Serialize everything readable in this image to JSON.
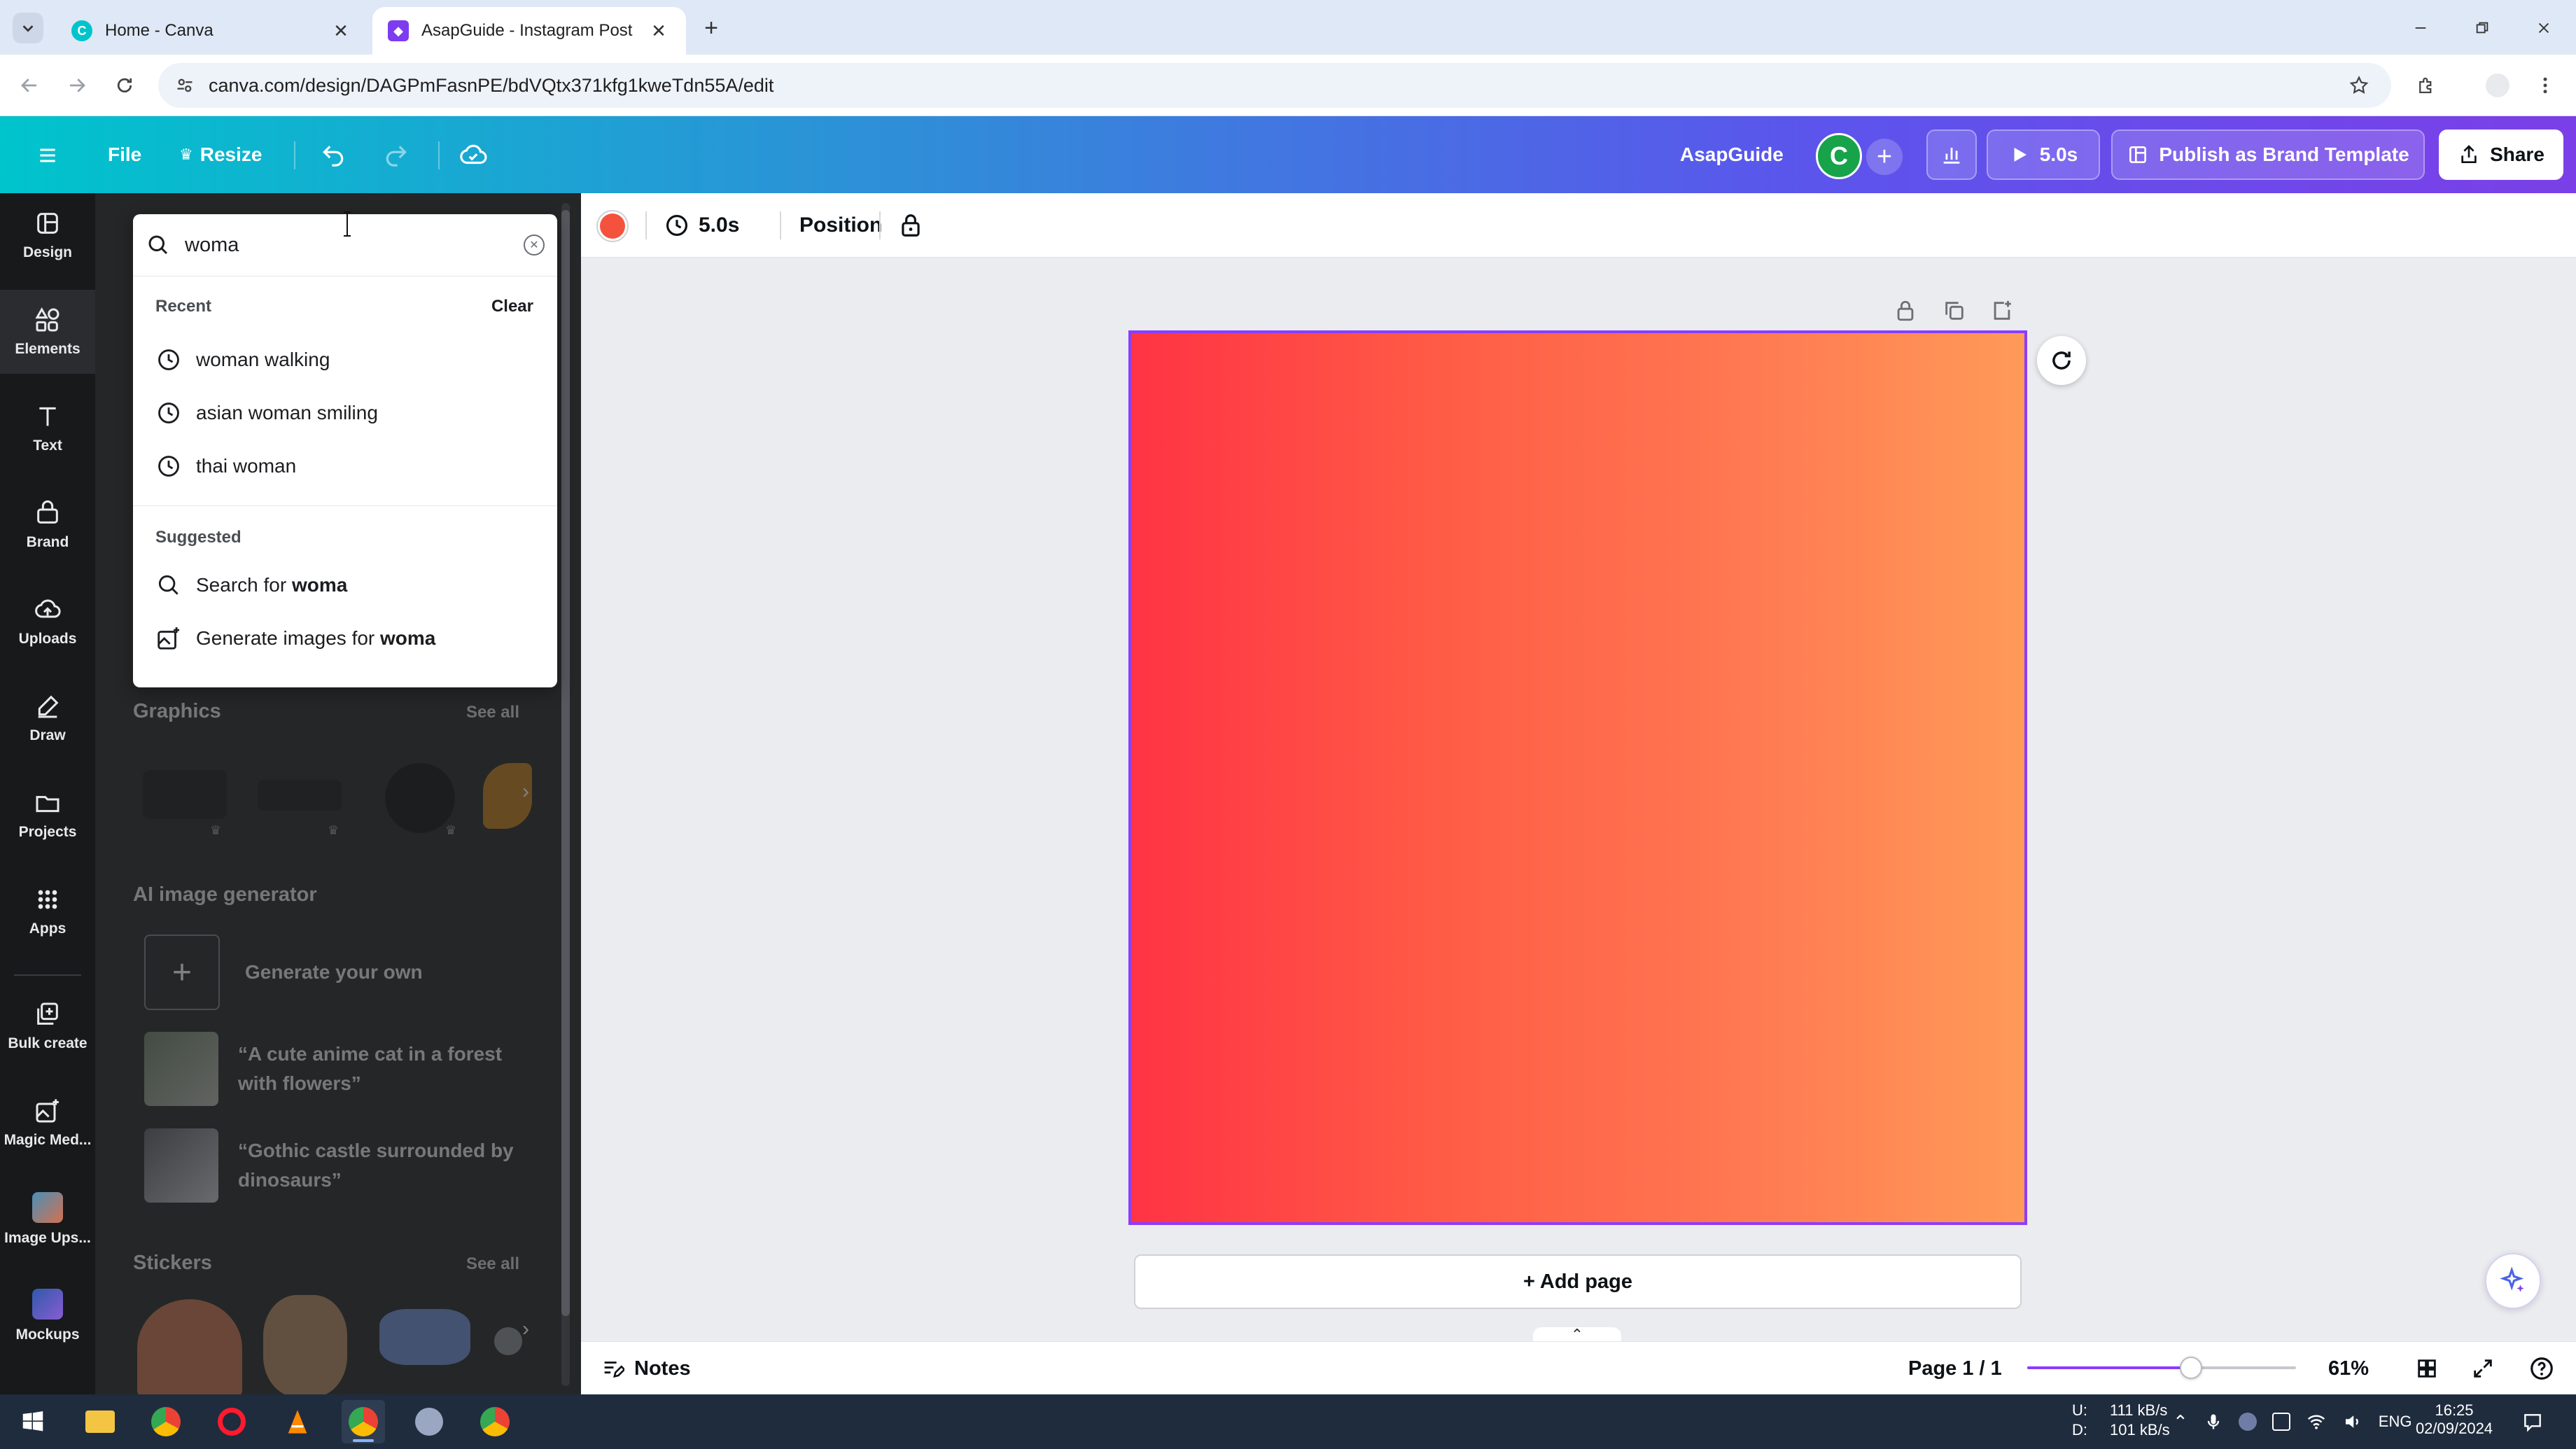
{
  "browser": {
    "tabs": [
      {
        "title": "Home - Canva",
        "active": false
      },
      {
        "title": "AsapGuide - Instagram Post",
        "active": true
      }
    ],
    "url": "canva.com/design/DAGPmFasnPE/bdVQtx371kfg1kweTdn55A/edit"
  },
  "topbar": {
    "file_label": "File",
    "resize_label": "Resize",
    "team_name": "AsapGuide",
    "avatar_initial": "C",
    "play_duration": "5.0s",
    "publish_label": "Publish as Brand Template",
    "share_label": "Share"
  },
  "rail": {
    "items": [
      {
        "label": "Design",
        "icon": "design-icon"
      },
      {
        "label": "Elements",
        "icon": "elements-icon",
        "active": true
      },
      {
        "label": "Text",
        "icon": "text-icon"
      },
      {
        "label": "Brand",
        "icon": "brand-icon"
      },
      {
        "label": "Uploads",
        "icon": "uploads-icon"
      },
      {
        "label": "Draw",
        "icon": "draw-icon"
      },
      {
        "label": "Projects",
        "icon": "projects-icon"
      },
      {
        "label": "Apps",
        "icon": "apps-icon"
      },
      {
        "label": "Bulk create",
        "icon": "bulk-create-icon"
      },
      {
        "label": "Magic Med...",
        "icon": "magic-media-icon"
      },
      {
        "label": "Image Ups...",
        "icon": "image-upscaler-icon"
      },
      {
        "label": "Mockups",
        "icon": "mockups-icon"
      }
    ]
  },
  "search": {
    "query": "woma",
    "recent_heading": "Recent",
    "clear_label": "Clear",
    "recent": [
      "woman walking",
      "asian woman smiling",
      "thai woman"
    ],
    "suggested_heading": "Suggested",
    "suggest_search_prefix": "Search for",
    "suggest_generate_prefix": "Generate images for",
    "suggest_term": "woma"
  },
  "panel": {
    "graphics_title": "Graphics",
    "see_all": "See all",
    "ai_title": "AI image generator",
    "generate_own": "Generate your own",
    "prompts": [
      "“A cute anime cat in a forest with flowers”",
      "“Gothic castle surrounded by dinosaurs”"
    ],
    "stickers_title": "Stickers"
  },
  "context_bar": {
    "duration": "5.0s",
    "position_label": "Position",
    "color": "#f4523d"
  },
  "canvas": {
    "add_page_label": "+ Add page",
    "gradient_start": "#ff3344",
    "gradient_end": "#ff9a58"
  },
  "footer": {
    "notes_label": "Notes",
    "page_indicator": "Page 1 / 1",
    "zoom_label": "61%",
    "zoom_level": 0.61
  },
  "taskbar": {
    "net_up_label": "U:",
    "net_down_label": "D:",
    "net_up": "111 kB/s",
    "net_down": "101 kB/s",
    "lang": "ENG",
    "time": "16:25",
    "date": "02/09/2024"
  },
  "colors": {
    "accent": "#8b3dff",
    "topbar_gradient_start": "#00c4cc",
    "topbar_gradient_end": "#7b3fe8"
  }
}
